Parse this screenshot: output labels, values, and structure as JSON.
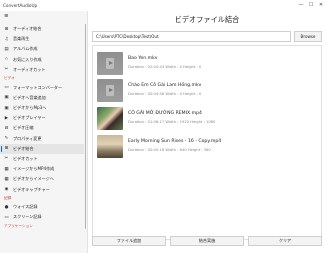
{
  "window": {
    "title": "ConvertAudioUp",
    "controls": [
      "—",
      "☐",
      "✕"
    ]
  },
  "sidebar": {
    "menu_glyph": "≡",
    "items": [
      {
        "type": "item",
        "label": "オーディオ結合",
        "icon": "merge-icon",
        "glyph": "⊞"
      },
      {
        "type": "item",
        "label": "音楽再生",
        "icon": "music-icon",
        "glyph": "♫"
      },
      {
        "type": "item",
        "label": "アルバム作成",
        "icon": "album-icon",
        "glyph": "▤"
      },
      {
        "type": "item",
        "label": "お気に入り作成",
        "icon": "star-icon",
        "glyph": "☆"
      },
      {
        "type": "item",
        "label": "オーディオカット",
        "icon": "scissors-icon",
        "glyph": "✂"
      },
      {
        "type": "section",
        "label": "ビデオ"
      },
      {
        "type": "item",
        "label": "フォーマットコンバーター",
        "icon": "format-icon",
        "glyph": "▭"
      },
      {
        "type": "item",
        "label": "ビデオへ音楽追加",
        "icon": "video-music-icon",
        "glyph": "▣"
      },
      {
        "type": "item",
        "label": "ビデオからMp3へ",
        "icon": "video-mp3-icon",
        "glyph": "▣"
      },
      {
        "type": "item",
        "label": "ビデオプレイヤー",
        "icon": "player-icon",
        "glyph": "▶"
      },
      {
        "type": "item",
        "label": "ビデオ圧縮",
        "icon": "compress-icon",
        "glyph": "⊟"
      },
      {
        "type": "item",
        "label": "プロパティ変更",
        "icon": "properties-icon",
        "glyph": "✎"
      },
      {
        "type": "item",
        "label": "ビデオ結合",
        "icon": "video-merge-icon",
        "glyph": "⊞",
        "selected": true
      },
      {
        "type": "item",
        "label": "ビデオカット",
        "icon": "video-cut-icon",
        "glyph": "✂"
      },
      {
        "type": "item",
        "label": "イメージからMP4作成",
        "icon": "image-mp4-icon",
        "glyph": "▦"
      },
      {
        "type": "item",
        "label": "ビデオからイメージへ",
        "icon": "video-image-icon",
        "glyph": "▦"
      },
      {
        "type": "item",
        "label": "ビデオキャプチャー",
        "icon": "capture-icon",
        "glyph": "◉"
      },
      {
        "type": "section",
        "label": "記録"
      },
      {
        "type": "item",
        "label": "ウォイス記録",
        "icon": "mic-icon",
        "glyph": "●"
      },
      {
        "type": "item",
        "label": "スクリーン記録",
        "icon": "screen-record-icon",
        "glyph": "▭"
      },
      {
        "type": "section",
        "label": "アプリケーション"
      }
    ]
  },
  "main": {
    "title": "ビデオファイル結合",
    "path_value": "C:\\Users\\PTC\\Desktop\\Test\\Out",
    "browse_label": "Browse",
    "files": [
      {
        "title": "Bao Yen.mkv",
        "meta": "Duration : 02:04:43  Width : 0  Height : 0",
        "thumb": "video"
      },
      {
        "title": "Chào Em Cô Gái Lam Hồng.mkv",
        "meta": "Duration : 00:04:56  Width : 0  Height : 0",
        "thumb": "video"
      },
      {
        "title": "CÔ GÁI MỞ ĐƯỜNG REMIX.mp4",
        "meta": "Duration : 01:06:17  Width : 1920  Height : 1080",
        "thumb": "photo-girl"
      },
      {
        "title": "Early Morning Sun Rises - 16 - Copy.mp4",
        "meta": "Duration : 00:00:16  Width : 640  Height : 360",
        "thumb": "photo-road"
      }
    ],
    "buttons": {
      "add": "ファイル追加",
      "merge": "結合実施",
      "clear": "クリア"
    }
  }
}
